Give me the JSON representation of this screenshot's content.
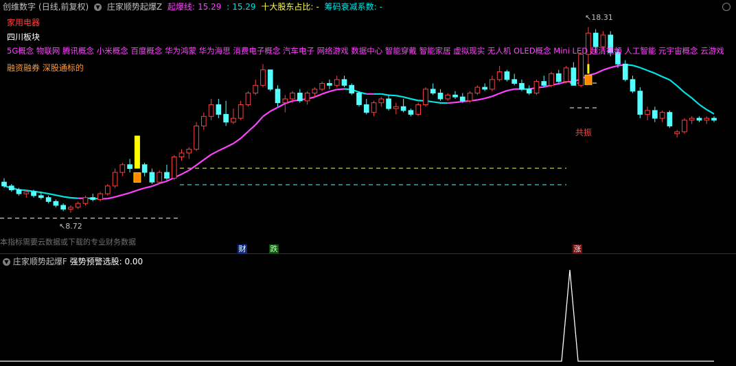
{
  "header": {
    "name": "创维数字",
    "mode": "(日线,前复权)",
    "indicator": "庄家顺势起爆Z",
    "line_label": "起爆线:",
    "line_val1": "15.29",
    "line_sep": ":",
    "line_val2": "15.29",
    "holders_label": "十大股东占比:",
    "holders_val": "-",
    "decay_label": "筹码衰减系数:",
    "decay_val": "-"
  },
  "tags": {
    "line1": "家用电器",
    "line2": "四川板块",
    "line3": "5G概念 物联网 腾讯概念 小米概念 百度概念 华为鸿蒙 华为海思 消费电子概念 汽车电子 网络游戏 数据中心 智能穿戴 智能家居 虚拟现实 无人机 OLED概念 Mini LED 超清视频 人工智能 元宇宙概念 云游戏",
    "line4": "融资融券 深股通标的"
  },
  "annotations": {
    "high": "18.31",
    "low": "8.72",
    "signal": "共振",
    "note": "本指标需要云数据或下载的专业财务数据"
  },
  "markers": {
    "cai": "财",
    "die": "跌",
    "zhang": "涨"
  },
  "lower": {
    "indicator": "庄家顺势起爆F",
    "label": "强势预警选股:",
    "value": "0.00"
  },
  "colors": {
    "up": "#ff4040",
    "down": "#54ffff",
    "ma_up": "#ff44ff",
    "ma_down": "#00e5e5",
    "signal": "#ffff00"
  },
  "chart_data": {
    "type": "candlestick",
    "ohlc": [
      [
        10.3,
        10.5,
        10.0,
        10.1
      ],
      [
        10.1,
        10.2,
        9.8,
        9.9
      ],
      [
        9.9,
        10.0,
        9.6,
        9.7
      ],
      [
        9.7,
        9.9,
        9.5,
        9.8
      ],
      [
        9.8,
        9.9,
        9.5,
        9.6
      ],
      [
        9.6,
        9.8,
        9.4,
        9.5
      ],
      [
        9.5,
        9.6,
        9.2,
        9.3
      ],
      [
        9.3,
        9.4,
        9.0,
        9.1
      ],
      [
        9.1,
        9.2,
        8.8,
        8.9
      ],
      [
        8.9,
        9.1,
        8.72,
        9.0
      ],
      [
        9.0,
        9.3,
        8.9,
        9.2
      ],
      [
        9.2,
        9.6,
        9.1,
        9.5
      ],
      [
        9.5,
        9.7,
        9.3,
        9.4
      ],
      [
        9.4,
        9.8,
        9.3,
        9.7
      ],
      [
        9.7,
        10.2,
        9.6,
        10.1
      ],
      [
        10.1,
        11.0,
        10.0,
        10.8
      ],
      [
        10.8,
        11.3,
        10.6,
        11.2
      ],
      [
        11.2,
        11.5,
        10.8,
        11.0
      ],
      [
        12.5,
        12.7,
        11.0,
        11.2
      ],
      [
        11.2,
        11.3,
        10.6,
        10.8
      ],
      [
        10.8,
        11.0,
        10.2,
        10.3
      ],
      [
        10.3,
        10.9,
        10.2,
        10.8
      ],
      [
        10.8,
        11.2,
        10.4,
        10.5
      ],
      [
        10.5,
        11.7,
        10.4,
        11.6
      ],
      [
        11.6,
        12.0,
        11.4,
        11.8
      ],
      [
        11.8,
        12.1,
        11.5,
        12.0
      ],
      [
        12.0,
        13.4,
        11.9,
        13.2
      ],
      [
        13.2,
        13.9,
        13.0,
        13.7
      ],
      [
        13.7,
        14.6,
        13.5,
        14.3
      ],
      [
        14.3,
        14.6,
        13.6,
        13.8
      ],
      [
        13.8,
        14.5,
        13.2,
        13.4
      ],
      [
        13.4,
        14.1,
        13.3,
        13.6
      ],
      [
        13.6,
        14.5,
        13.5,
        14.3
      ],
      [
        14.3,
        15.0,
        14.2,
        14.9
      ],
      [
        14.9,
        15.6,
        14.8,
        15.3
      ],
      [
        15.3,
        16.4,
        15.2,
        16.1
      ],
      [
        16.1,
        16.0,
        15.0,
        15.1
      ],
      [
        15.1,
        15.3,
        14.2,
        14.4
      ],
      [
        14.4,
        14.8,
        13.9,
        14.6
      ],
      [
        14.6,
        15.0,
        14.4,
        14.9
      ],
      [
        14.9,
        15.1,
        14.4,
        14.5
      ],
      [
        14.5,
        15.0,
        14.3,
        14.9
      ],
      [
        14.9,
        15.2,
        14.7,
        15.1
      ],
      [
        15.1,
        15.5,
        15.0,
        15.4
      ],
      [
        15.4,
        15.6,
        15.1,
        15.3
      ],
      [
        15.3,
        15.8,
        15.2,
        15.6
      ],
      [
        15.6,
        15.8,
        15.2,
        15.3
      ],
      [
        15.3,
        15.4,
        14.8,
        14.9
      ],
      [
        14.9,
        15.0,
        14.2,
        14.3
      ],
      [
        14.3,
        14.6,
        13.8,
        13.9
      ],
      [
        13.9,
        14.5,
        13.7,
        14.4
      ],
      [
        14.4,
        14.7,
        14.2,
        14.6
      ],
      [
        14.6,
        14.8,
        14.0,
        14.1
      ],
      [
        14.1,
        14.4,
        13.8,
        14.2
      ],
      [
        14.2,
        14.6,
        13.9,
        14.0
      ],
      [
        14.0,
        14.1,
        13.7,
        13.8
      ],
      [
        13.8,
        14.4,
        13.7,
        14.3
      ],
      [
        14.3,
        15.2,
        14.2,
        15.1
      ],
      [
        15.1,
        15.4,
        14.8,
        14.9
      ],
      [
        14.9,
        15.1,
        14.5,
        14.6
      ],
      [
        14.6,
        14.9,
        14.5,
        14.8
      ],
      [
        14.8,
        15.0,
        14.6,
        14.7
      ],
      [
        14.7,
        14.9,
        14.4,
        14.5
      ],
      [
        14.5,
        15.0,
        14.4,
        14.9
      ],
      [
        14.9,
        15.3,
        14.8,
        15.2
      ],
      [
        15.2,
        15.4,
        15.0,
        15.1
      ],
      [
        15.1,
        15.8,
        15.0,
        15.6
      ],
      [
        15.6,
        16.3,
        15.5,
        16.0
      ],
      [
        16.0,
        16.1,
        15.5,
        15.6
      ],
      [
        15.6,
        15.9,
        15.3,
        15.4
      ],
      [
        15.4,
        15.6,
        15.0,
        15.1
      ],
      [
        15.1,
        15.3,
        14.8,
        14.9
      ],
      [
        14.9,
        15.6,
        14.8,
        15.5
      ],
      [
        15.5,
        15.8,
        15.2,
        15.3
      ],
      [
        15.3,
        16.0,
        15.2,
        15.9
      ],
      [
        15.9,
        16.1,
        15.4,
        15.5
      ],
      [
        15.5,
        16.3,
        15.4,
        16.2
      ],
      [
        16.2,
        16.5,
        15.3,
        15.3
      ],
      [
        15.3,
        17.0,
        15.2,
        16.9
      ],
      [
        16.9,
        18.31,
        16.4,
        18.0
      ],
      [
        18.0,
        18.2,
        17.0,
        17.3
      ],
      [
        17.3,
        18.1,
        17.1,
        17.9
      ],
      [
        17.9,
        18.1,
        16.8,
        17.0
      ],
      [
        17.0,
        17.2,
        16.2,
        16.4
      ],
      [
        16.4,
        16.6,
        15.5,
        15.6
      ],
      [
        15.6,
        15.8,
        14.9,
        15.0
      ],
      [
        15.0,
        15.2,
        13.6,
        13.8
      ],
      [
        13.8,
        14.2,
        13.5,
        14.0
      ],
      [
        14.0,
        14.2,
        13.4,
        13.6
      ],
      [
        13.6,
        14.0,
        13.4,
        13.9
      ],
      [
        13.9,
        14.0,
        13.1,
        13.2
      ],
      [
        12.8,
        13.0,
        12.6,
        12.9
      ],
      [
        12.9,
        13.6,
        12.8,
        13.5
      ],
      [
        13.5,
        13.7,
        13.3,
        13.6
      ],
      [
        13.6,
        13.7,
        13.4,
        13.5
      ],
      [
        13.5,
        13.7,
        13.3,
        13.6
      ],
      [
        13.6,
        13.7,
        13.4,
        13.5
      ]
    ],
    "high_label": 18.31,
    "low_label": 8.72,
    "ylim": [
      8.0,
      19.0
    ]
  }
}
